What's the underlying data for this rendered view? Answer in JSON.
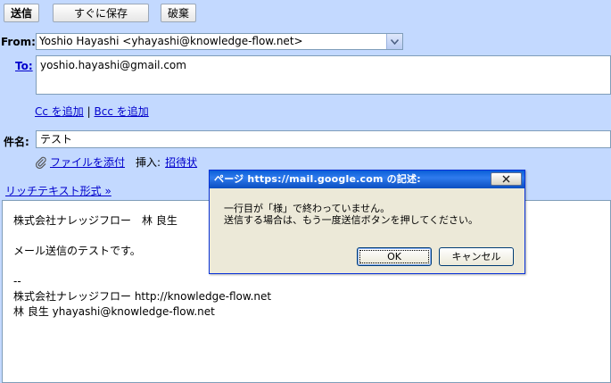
{
  "toolbar": {
    "send_label": "送信",
    "save_now_label": "すぐに保存",
    "discard_label": "破棄"
  },
  "compose": {
    "from_label": "From:",
    "from_value": "Yoshio Hayashi <yhayashi@knowledge-flow.net>",
    "to_label": "To:",
    "to_value": "yoshio.hayashi@gmail.com",
    "cc_link": "Cc を追加",
    "separator": "|",
    "bcc_link": "Bcc を追加",
    "subject_label": "件名:",
    "subject_value": "テスト",
    "attach_link": "ファイルを添付",
    "insert_label": "挿入:",
    "invite_link": "招待状",
    "rich_text_link": "リッチテキスト形式 »",
    "body_lines": [
      "株式会社ナレッジフロー　林 良生",
      "",
      "メール送信のテストです。",
      "",
      "--",
      "株式会社ナレッジフロー http://knowledge-flow.net",
      "林 良生 yhayashi@knowledge-flow.net"
    ]
  },
  "dialog": {
    "title": "ページ https://mail.google.com の記述:",
    "message_line1": "一行目が「様」で終わっていません。",
    "message_line2": "送信する場合は、もう一度送信ボタンを押してください。",
    "ok_label": "OK",
    "cancel_label": "キャンセル"
  }
}
